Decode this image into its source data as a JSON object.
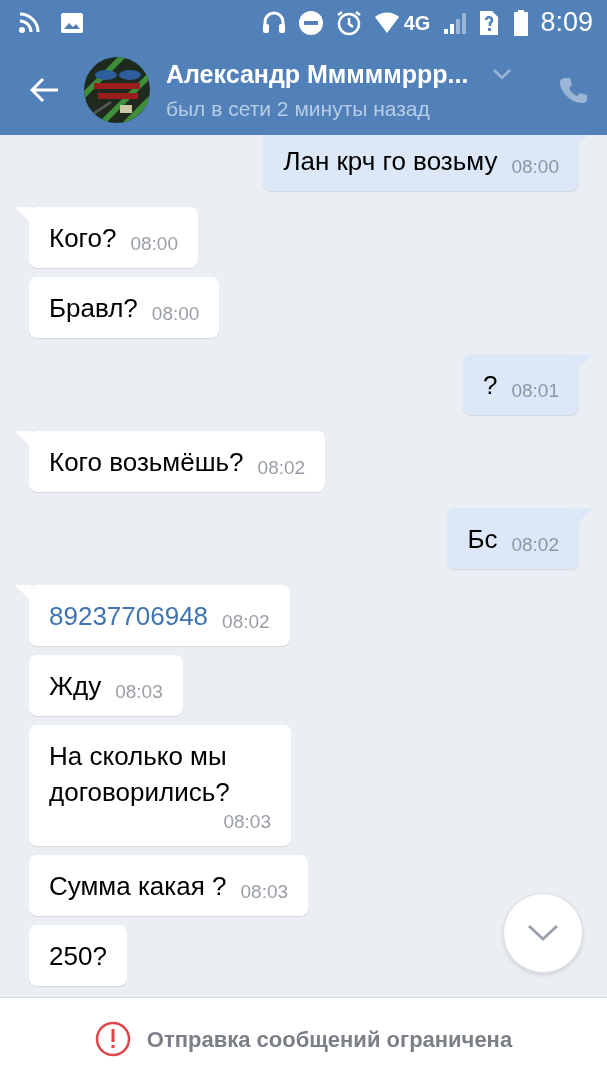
{
  "status_bar": {
    "network": "4G",
    "time": "8:09"
  },
  "header": {
    "title": "Александр Мммммррр...",
    "subtitle": "был в сети 2 минуты назад"
  },
  "messages": [
    {
      "outgoing": true,
      "kind": "text",
      "text": "Лан крч го возьму",
      "time": "08:00",
      "tail": true
    },
    {
      "outgoing": false,
      "kind": "text",
      "text": "Кого?",
      "time": "08:00",
      "tail": true
    },
    {
      "outgoing": false,
      "kind": "text",
      "text": "Бравл?",
      "time": "08:00",
      "tail": false
    },
    {
      "outgoing": true,
      "kind": "text",
      "text": "?",
      "time": "08:01",
      "tail": true
    },
    {
      "outgoing": false,
      "kind": "text",
      "text": "Кого возьмёшь?",
      "time": "08:02",
      "tail": true
    },
    {
      "outgoing": true,
      "kind": "text",
      "text": "Бс",
      "time": "08:02",
      "tail": true
    },
    {
      "outgoing": false,
      "kind": "link",
      "text": "89237706948",
      "time": "08:02",
      "tail": true
    },
    {
      "outgoing": false,
      "kind": "text",
      "text": "Жду",
      "time": "08:03",
      "tail": false
    },
    {
      "outgoing": false,
      "kind": "multiline",
      "text": "На сколько мы договорились?",
      "time": "08:03",
      "tail": false
    },
    {
      "outgoing": false,
      "kind": "text",
      "text": "Сумма какая ?",
      "time": "08:03",
      "tail": false
    },
    {
      "outgoing": false,
      "kind": "text",
      "text": "250?",
      "tail": false
    }
  ],
  "footer": {
    "notice": "Отправка сообщений ограничена"
  }
}
